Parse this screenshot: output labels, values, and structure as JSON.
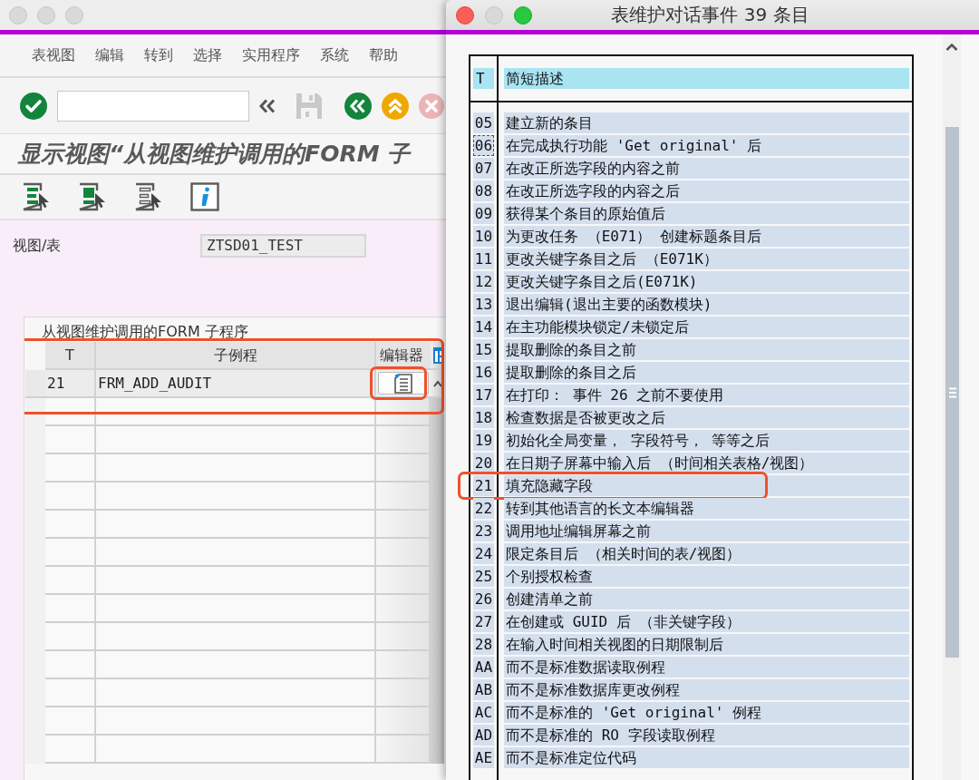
{
  "main_window": {
    "active": false,
    "menu": [
      "表视图",
      "编辑",
      "转到",
      "选择",
      "实用程序",
      "系统",
      "帮助"
    ],
    "toolbar": [
      {
        "kind": "enter",
        "disabled": false
      },
      {
        "kind": "command_field",
        "disabled": false
      },
      {
        "kind": "toggle",
        "disabled": false
      },
      {
        "kind": "save",
        "disabled": true
      },
      {
        "kind": "back",
        "disabled": false
      },
      {
        "kind": "exit",
        "disabled": false
      },
      {
        "kind": "cancel",
        "disabled": true
      }
    ],
    "title": "显示视图“从视图维护调用的FORM 子",
    "app_toolbar": [
      {
        "kind": "select_all"
      },
      {
        "kind": "select_block"
      },
      {
        "kind": "deselect_all"
      },
      {
        "kind": "info"
      }
    ],
    "view_field": {
      "label": "视图/表",
      "value": "ZTSD01_TEST"
    },
    "table": {
      "title": "从视图维护调用的FORM 子程序",
      "columns": [
        "T",
        "子例程",
        "编辑器"
      ],
      "rows": [
        {
          "cells": [
            "21",
            "FRM_ADD_AUDIT"
          ],
          "highlighted": true,
          "editor_button": {
            "highlighted": true
          }
        }
      ]
    }
  },
  "dialog": {
    "active": true,
    "window_buttons": [
      {
        "kind": "close",
        "disabled": false
      },
      {
        "kind": "minimize",
        "disabled": true
      },
      {
        "kind": "zoom",
        "disabled": false
      }
    ],
    "title": "表维护对话事件 39 条目",
    "columns": [
      "T",
      "简短描述"
    ],
    "rows": [
      {
        "cells": [
          "05",
          "建立新的条目"
        ],
        "focused": false,
        "highlighted": false
      },
      {
        "cells": [
          "06",
          "在完成执行功能 'Get original' 后"
        ],
        "focused": true,
        "highlighted": false
      },
      {
        "cells": [
          "07",
          "在改正所选字段的内容之前"
        ],
        "focused": false,
        "highlighted": false
      },
      {
        "cells": [
          "08",
          "在改正所选字段的内容之后"
        ],
        "focused": false,
        "highlighted": false
      },
      {
        "cells": [
          "09",
          "获得某个条目的原始值后"
        ],
        "focused": false,
        "highlighted": false
      },
      {
        "cells": [
          "10",
          "为更改任务 （E071） 创建标题条目后"
        ],
        "focused": false,
        "highlighted": false
      },
      {
        "cells": [
          "11",
          "更改关键字条目之后 （E071K）"
        ],
        "focused": false,
        "highlighted": false
      },
      {
        "cells": [
          "12",
          "更改关键字条目之后(E071K)"
        ],
        "focused": false,
        "highlighted": false
      },
      {
        "cells": [
          "13",
          "退出编辑(退出主要的函数模块)"
        ],
        "focused": false,
        "highlighted": false
      },
      {
        "cells": [
          "14",
          "在主功能模块锁定/未锁定后"
        ],
        "focused": false,
        "highlighted": false
      },
      {
        "cells": [
          "15",
          "提取删除的条目之前"
        ],
        "focused": false,
        "highlighted": false
      },
      {
        "cells": [
          "16",
          "提取删除的条目之后"
        ],
        "focused": false,
        "highlighted": false
      },
      {
        "cells": [
          "17",
          "在打印： 事件 26 之前不要使用"
        ],
        "focused": false,
        "highlighted": false
      },
      {
        "cells": [
          "18",
          "检查数据是否被更改之后"
        ],
        "focused": false,
        "highlighted": false
      },
      {
        "cells": [
          "19",
          "初始化全局变量， 字段符号， 等等之后"
        ],
        "focused": false,
        "highlighted": false
      },
      {
        "cells": [
          "20",
          "在日期子屏幕中输入后 （时间相关表格/视图）"
        ],
        "focused": false,
        "highlighted": false
      },
      {
        "cells": [
          "21",
          "填充隐藏字段"
        ],
        "focused": false,
        "highlighted": true
      },
      {
        "cells": [
          "22",
          "转到其他语言的长文本编辑器"
        ],
        "focused": false,
        "highlighted": false
      },
      {
        "cells": [
          "23",
          "调用地址编辑屏幕之前"
        ],
        "focused": false,
        "highlighted": false
      },
      {
        "cells": [
          "24",
          "限定条目后 （相关时间的表/视图）"
        ],
        "focused": false,
        "highlighted": false
      },
      {
        "cells": [
          "25",
          "个别授权检查"
        ],
        "focused": false,
        "highlighted": false
      },
      {
        "cells": [
          "26",
          "创建清单之前"
        ],
        "focused": false,
        "highlighted": false
      },
      {
        "cells": [
          "27",
          "在创建或 GUID 后 （非关键字段）"
        ],
        "focused": false,
        "highlighted": false
      },
      {
        "cells": [
          "28",
          "在输入时间相关视图的日期限制后"
        ],
        "focused": false,
        "highlighted": false
      },
      {
        "cells": [
          "AA",
          "而不是标准数据读取例程"
        ],
        "focused": false,
        "highlighted": false
      },
      {
        "cells": [
          "AB",
          "而不是标准数据库更改例程"
        ],
        "focused": false,
        "highlighted": false
      },
      {
        "cells": [
          "AC",
          "而不是标准的 'Get original' 例程"
        ],
        "focused": false,
        "highlighted": false
      },
      {
        "cells": [
          "AD",
          "而不是标准的 RO 字段读取例程"
        ],
        "focused": false,
        "highlighted": false
      },
      {
        "cells": [
          "AE",
          "而不是标准定位代码"
        ],
        "focused": false,
        "highlighted": false
      }
    ]
  }
}
